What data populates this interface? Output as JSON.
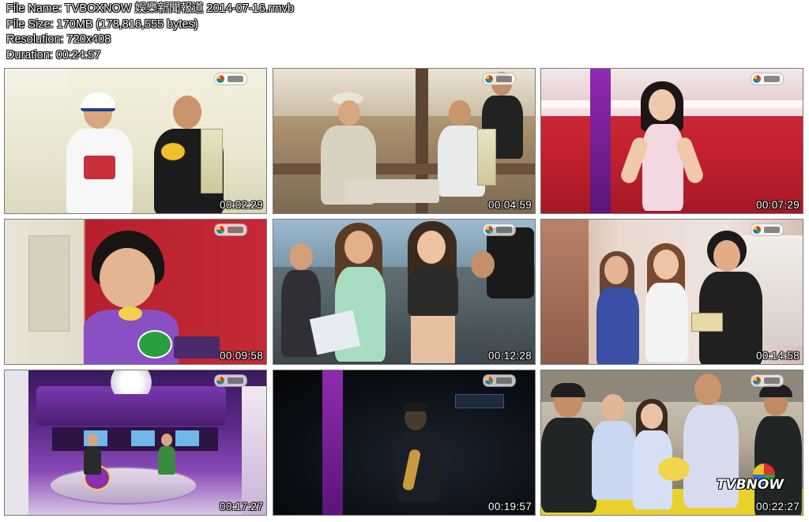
{
  "file_info": {
    "file_name": "File Name: TVBOXNOW 娛樂新聞報道 2014-07-16.rmvb",
    "file_size": "File Size: 170MB (178,816,555 bytes)",
    "resolution": "Resolution: 720x408",
    "duration": "Duration: 00:24:57"
  },
  "thumbnails": [
    {
      "timestamp": "00:02:29"
    },
    {
      "timestamp": "00:04:59"
    },
    {
      "timestamp": "00:07:29"
    },
    {
      "timestamp": "00:09:58"
    },
    {
      "timestamp": "00:12:28"
    },
    {
      "timestamp": "00:14:58"
    },
    {
      "timestamp": "00:17:27"
    },
    {
      "timestamp": "00:19:57"
    },
    {
      "timestamp": "00:22:27"
    }
  ],
  "watermark": {
    "text": "TVBNOW"
  },
  "icons": {
    "channel_logo": "tvb-j2-logo-icon"
  }
}
